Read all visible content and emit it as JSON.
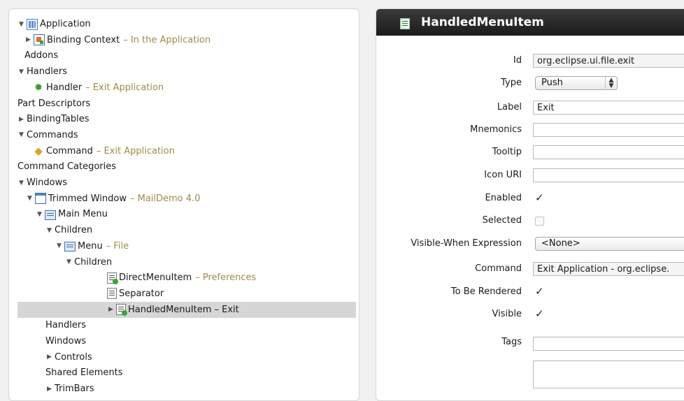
{
  "tree": {
    "rows": [
      {
        "twisty": "▼",
        "icon": "application-icon",
        "label": "Application",
        "desc": ""
      },
      {
        "twisty": "▶",
        "icon": "binding-context-icon",
        "label": "Binding Context",
        "desc": "– In the Application"
      },
      {
        "twisty": "",
        "icon": "",
        "label": "Addons",
        "desc": ""
      },
      {
        "twisty": "▼",
        "icon": "",
        "label": "Handlers",
        "desc": ""
      },
      {
        "twisty": "",
        "icon": "handler-gear-icon",
        "label": "Handler",
        "desc": "– Exit Application"
      },
      {
        "twisty": "",
        "icon": "",
        "label": "Part Descriptors",
        "desc": ""
      },
      {
        "twisty": "▶",
        "icon": "",
        "label": "BindingTables",
        "desc": ""
      },
      {
        "twisty": "▼",
        "icon": "",
        "label": "Commands",
        "desc": ""
      },
      {
        "twisty": "",
        "icon": "command-icon",
        "label": "Command",
        "desc": "– Exit Application"
      },
      {
        "twisty": "",
        "icon": "",
        "label": "Command Categories",
        "desc": ""
      },
      {
        "twisty": "▼",
        "icon": "",
        "label": "Windows",
        "desc": ""
      },
      {
        "twisty": "▼",
        "icon": "window-icon",
        "label": "Trimmed Window",
        "desc": "– MailDemo 4.0"
      },
      {
        "twisty": "▼",
        "icon": "menu-icon",
        "label": "Main Menu",
        "desc": ""
      },
      {
        "twisty": "▼",
        "icon": "",
        "label": "Children",
        "desc": ""
      },
      {
        "twisty": "▼",
        "icon": "menu-icon",
        "label": "Menu",
        "desc": "– File"
      },
      {
        "twisty": "▼",
        "icon": "",
        "label": "Children",
        "desc": ""
      },
      {
        "twisty": "",
        "icon": "direct-menu-item-icon",
        "label": "DirectMenuItem",
        "desc": "– Preferences"
      },
      {
        "twisty": "",
        "icon": "separator-icon",
        "label": "Separator",
        "desc": ""
      },
      {
        "twisty": "▶",
        "icon": "handled-menu-item-icon",
        "label": "HandledMenuItem – Exit",
        "desc": ""
      },
      {
        "twisty": "",
        "icon": "",
        "label": "Handlers",
        "desc": ""
      },
      {
        "twisty": "",
        "icon": "",
        "label": "Windows",
        "desc": ""
      },
      {
        "twisty": "▶",
        "icon": "",
        "label": "Controls",
        "desc": ""
      },
      {
        "twisty": "",
        "icon": "",
        "label": "Shared Elements",
        "desc": ""
      },
      {
        "twisty": "▶",
        "icon": "",
        "label": "TrimBars",
        "desc": ""
      }
    ],
    "selected_index": 18
  },
  "editor": {
    "title": "HandledMenuItem",
    "fields": {
      "id": {
        "label": "Id",
        "value": "org.eclipse.ui.file.exit"
      },
      "type": {
        "label": "Type",
        "value": "Push"
      },
      "label": {
        "label": "Label",
        "value": "Exit"
      },
      "mnemonics": {
        "label": "Mnemonics",
        "value": ""
      },
      "tooltip": {
        "label": "Tooltip",
        "value": ""
      },
      "icon_uri": {
        "label": "Icon URI",
        "value": ""
      },
      "enabled": {
        "label": "Enabled",
        "checked": true
      },
      "selected": {
        "label": "Selected",
        "checked": false
      },
      "visible_when": {
        "label": "Visible-When Expression",
        "value": "<None>"
      },
      "command": {
        "label": "Command",
        "value": "Exit Application - org.eclipse."
      },
      "to_be_rendered": {
        "label": "To Be Rendered",
        "checked": true
      },
      "visible": {
        "label": "Visible",
        "checked": true
      },
      "tags": {
        "label": "Tags",
        "value": ""
      }
    }
  }
}
